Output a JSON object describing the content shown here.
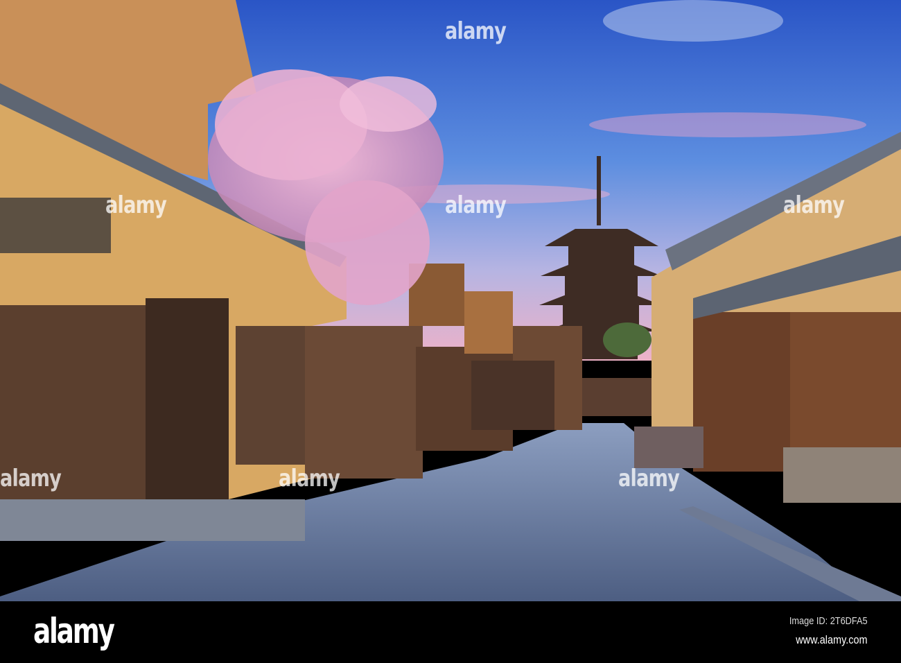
{
  "watermark": "alamy",
  "footer": {
    "logo": "alamy",
    "image_id": "Image ID: 2T6DFA5",
    "website": "www.alamy.com"
  },
  "colors": {
    "sky_top": "#2c57c9",
    "sky_horizon": "#e9a6c6",
    "cherry_blossom": "#e8a9cc",
    "wall": "#d9a865",
    "wood": "#5a3d2b",
    "street": "#5d6f92"
  }
}
